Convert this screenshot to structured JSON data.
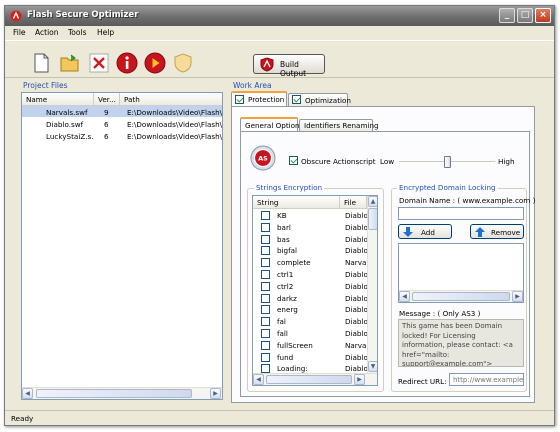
{
  "window": {
    "title": "Flash Secure Optimizer",
    "min_label": "_",
    "max_label": "□",
    "close_label": "×"
  },
  "menu": [
    "File",
    "Action",
    "Tools",
    "Help"
  ],
  "toolbar": {
    "build_label": "Build Output"
  },
  "project_files": {
    "title": "Project Files",
    "headers": [
      "Name",
      "Ver...",
      "Path"
    ],
    "rows": [
      {
        "name": "Narvals.swf",
        "version": "9",
        "path": "E:\\Downloads\\Video\\Flash\\",
        "selected": true
      },
      {
        "name": "Diablo.swf",
        "version": "6",
        "path": "E:\\Downloads\\Video\\Flash\\",
        "selected": false
      },
      {
        "name": "LuckyStaiZ.s...",
        "version": "6",
        "path": "E:\\Downloads\\Video\\Flash\\",
        "selected": false
      }
    ]
  },
  "work_area": {
    "title": "Work Area",
    "tabs": [
      {
        "label": "Protection",
        "checked": true,
        "active": true
      },
      {
        "label": "Optimization",
        "checked": true,
        "active": false
      }
    ],
    "subtabs": [
      {
        "label": "General Options",
        "active": true
      },
      {
        "label": "Identifiers Renaming",
        "active": false
      }
    ],
    "obscure": {
      "label": "Obscure Actionscript",
      "checked": true,
      "low_label": "Low",
      "high_label": "High",
      "level": 0.5
    },
    "strings_encryption": {
      "title": "Strings Encryption",
      "headers": [
        "String",
        "File"
      ],
      "rows": [
        {
          "string": "KB",
          "file": "Diablo"
        },
        {
          "string": "barl",
          "file": "Diablo"
        },
        {
          "string": "bas",
          "file": "Diablo"
        },
        {
          "string": "bigfal",
          "file": "Diablo"
        },
        {
          "string": "complete",
          "file": "Narva"
        },
        {
          "string": "ctrl1",
          "file": "Diablo"
        },
        {
          "string": "ctrl2",
          "file": "Diablo"
        },
        {
          "string": "darkz",
          "file": "Diablo"
        },
        {
          "string": "energ",
          "file": "Diablo"
        },
        {
          "string": "fal",
          "file": "Diablo"
        },
        {
          "string": "fall",
          "file": "Diablo"
        },
        {
          "string": "fullScreen",
          "file": "Narva"
        },
        {
          "string": "fund",
          "file": "Diablo"
        },
        {
          "string": "Loading:",
          "file": "Diablo"
        }
      ]
    },
    "domain_locking": {
      "title": "Encrypted Domain Locking",
      "domain_label": "Domain Name :  ( www.example.com )",
      "domain_value": "",
      "add_label": "Add",
      "remove_label": "Remove",
      "message_label": "Message : ( Only AS3 )",
      "message_text": "This game has been Domain locked! For Licensing information, please contact: <a href=\"mailto: support@example.com\"> support@example.com </a>",
      "redirect_label": "Redirect URL:",
      "redirect_placeholder": "http://www.example.com"
    }
  },
  "status": "Ready",
  "colors": {
    "group_title": "#2250b6",
    "selection": "#c1d2ee",
    "tab_accent": "#f1a23a"
  }
}
